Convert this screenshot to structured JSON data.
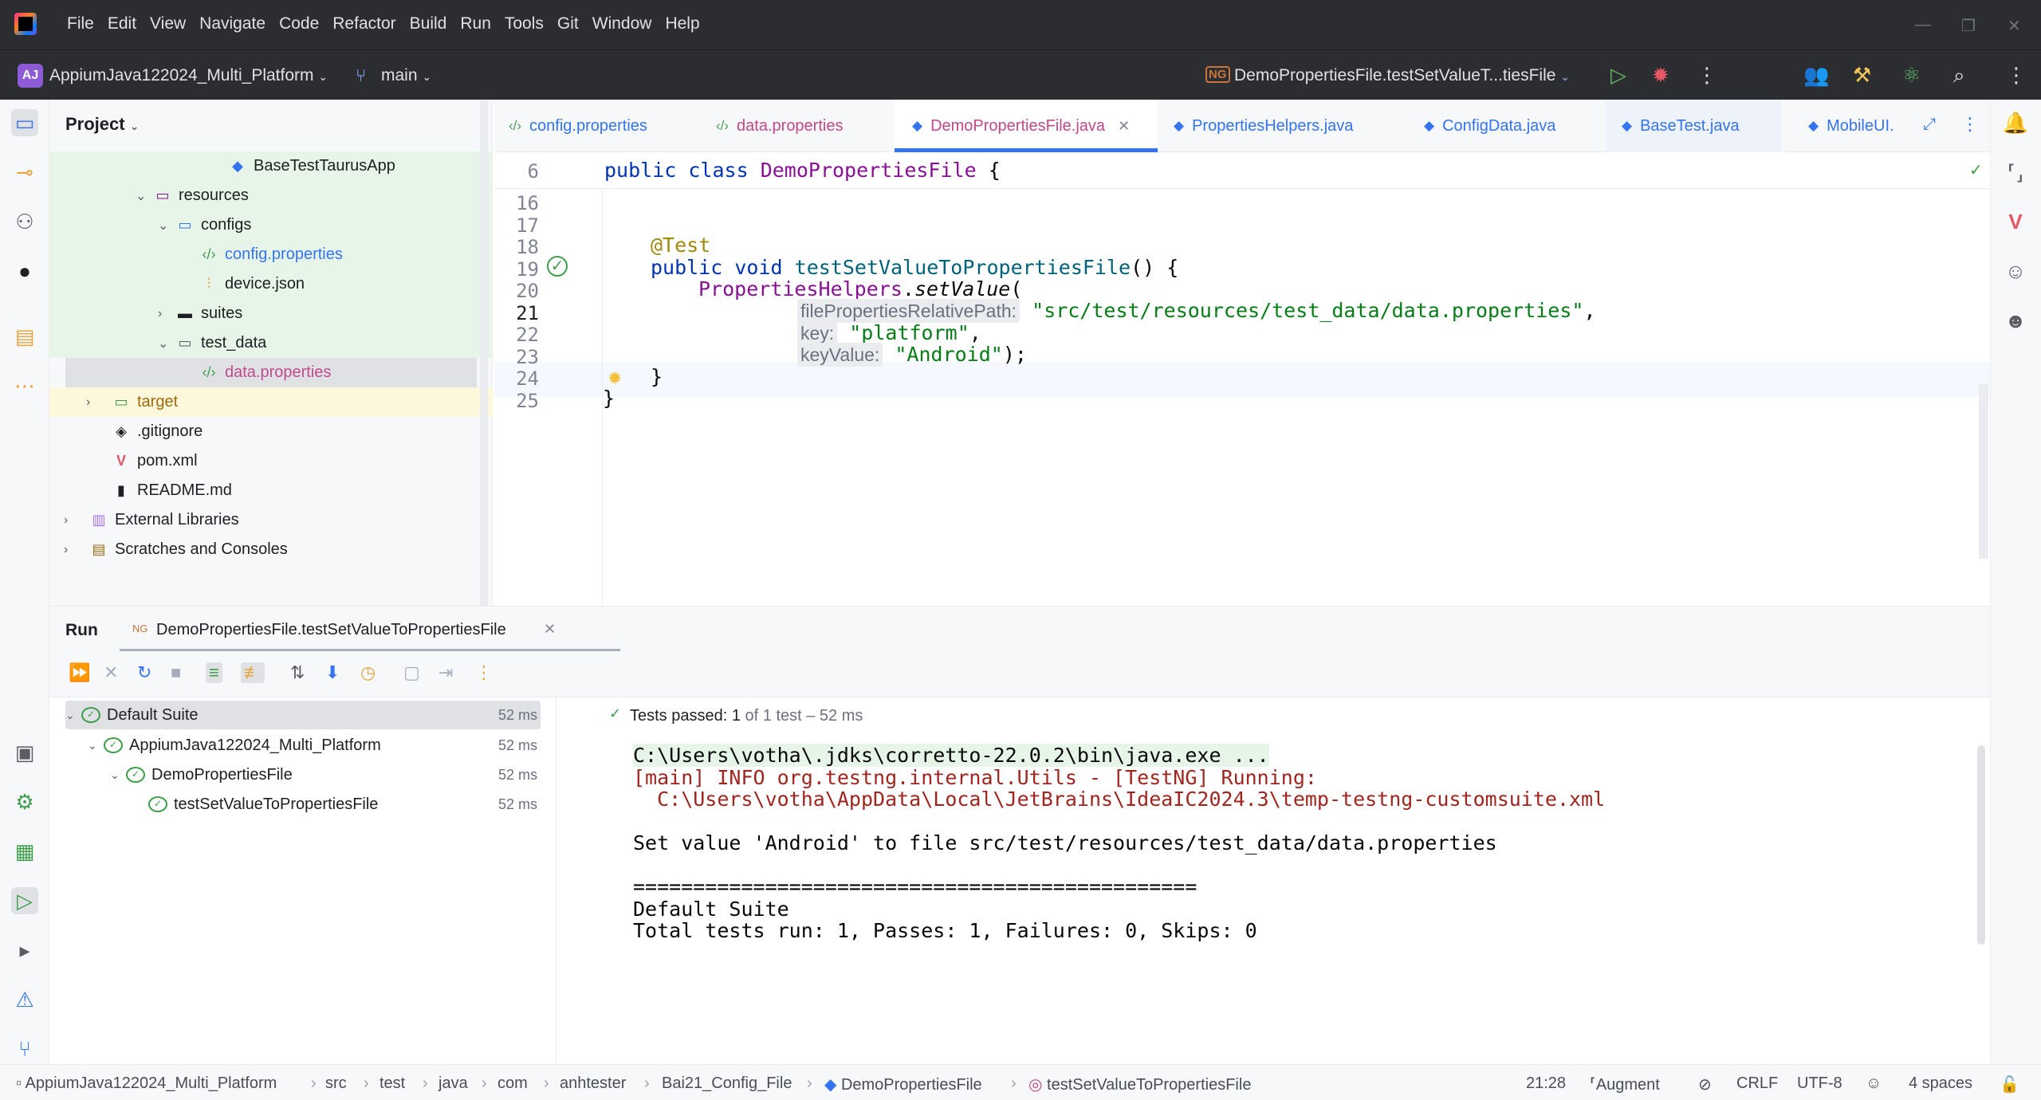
{
  "menu": [
    "File",
    "Edit",
    "View",
    "Navigate",
    "Code",
    "Refactor",
    "Build",
    "Run",
    "Tools",
    "Git",
    "Window",
    "Help"
  ],
  "toolbar": {
    "project_badge": "AJ",
    "project_name": "AppiumJava122024_Multi_Platform",
    "branch": "main",
    "run_config_icon": "NG",
    "run_config": "DemoPropertiesFile.testSetValueT...tiesFile"
  },
  "project_panel": {
    "title": "Project",
    "items": [
      {
        "label": "BaseTestTaurusApp",
        "icon": "class-icon"
      },
      {
        "label": "resources",
        "icon": "folder-icon"
      },
      {
        "label": "configs",
        "icon": "folder-icon"
      },
      {
        "label": "config.properties",
        "icon": "properties-icon"
      },
      {
        "label": "device.json",
        "icon": "json-icon"
      },
      {
        "label": "suites",
        "icon": "folder-icon"
      },
      {
        "label": "test_data",
        "icon": "folder-icon"
      },
      {
        "label": "data.properties",
        "icon": "properties-icon"
      },
      {
        "label": "target",
        "icon": "folder-icon"
      },
      {
        "label": ".gitignore",
        "icon": "git-icon"
      },
      {
        "label": "pom.xml",
        "icon": "maven-icon"
      },
      {
        "label": "README.md",
        "icon": "markdown-icon"
      },
      {
        "label": "External Libraries",
        "icon": "library-icon"
      },
      {
        "label": "Scratches and Consoles",
        "icon": "scratches-icon"
      }
    ]
  },
  "editor_tabs": [
    {
      "label": "config.properties"
    },
    {
      "label": "data.properties"
    },
    {
      "label": "DemoPropertiesFile.java"
    },
    {
      "label": "PropertiesHelpers.java"
    },
    {
      "label": "ConfigData.java"
    },
    {
      "label": "BaseTest.java"
    },
    {
      "label": "MobileUI."
    }
  ],
  "editor": {
    "sticky": {
      "line": "6",
      "kw1": "public",
      "kw2": "class",
      "name": "DemoPropertiesFile",
      "rest": "{"
    },
    "lines": [
      "16",
      "17",
      "18",
      "19",
      "20",
      "21",
      "22",
      "23",
      "24",
      "25"
    ],
    "annotation": "@Test",
    "method_kw": "public void",
    "method_name": "testSetValueToPropertiesFile",
    "method_rest": "() {",
    "call_class": "PropertiesHelpers",
    "call_method": "setValue",
    "call_open": "(",
    "hint1": "filePropertiesRelativePath:",
    "arg1": "\"src/test/resources/test_data/data.properties\"",
    "hint2": "key:",
    "arg2": "\"platform\"",
    "hint3": "keyValue:",
    "arg3": "\"Android\"",
    "close_call": ");",
    "close_method": "}",
    "close_class": "}",
    "comma": ","
  },
  "run_panel": {
    "title": "Run",
    "tab_label": "DemoPropertiesFile.testSetValueToPropertiesFile",
    "tests_passed_label": "Tests passed:",
    "tests_passed_count": "1",
    "tests_passed_rest": "of 1 test – 52 ms",
    "tree": [
      {
        "label": "Default Suite",
        "time": "52 ms"
      },
      {
        "label": "AppiumJava122024_Multi_Platform",
        "time": "52 ms"
      },
      {
        "label": "DemoPropertiesFile",
        "time": "52 ms"
      },
      {
        "label": "testSetValueToPropertiesFile",
        "time": "52 ms"
      }
    ],
    "console": [
      "C:\\Users\\votha\\.jdks\\corretto-22.0.2\\bin\\java.exe ...",
      "[main] INFO org.testng.internal.Utils - [TestNG] Running:",
      "  C:\\Users\\votha\\AppData\\Local\\JetBrains\\IdeaIC2024.3\\temp-testng-customsuite.xml",
      "Set value 'Android' to file src/test/resources/test_data/data.properties",
      "===============================================",
      "Default Suite",
      "Total tests run: 1, Passes: 1, Failures: 0, Skips: 0"
    ]
  },
  "statusbar": {
    "breadcrumbs": [
      "AppiumJava122024_Multi_Platform",
      "src",
      "test",
      "java",
      "com",
      "anhtester",
      "Bai21_Config_File",
      "DemoPropertiesFile",
      "testSetValueToPropertiesFile"
    ],
    "position": "21:28",
    "augment": "Augment",
    "line_sep": "CRLF",
    "encoding": "UTF-8",
    "indent": "4 spaces"
  },
  "colors": {
    "accent": "#3574f0",
    "pass": "#3f9e4c",
    "dark_chrome": "#2b2d30"
  }
}
